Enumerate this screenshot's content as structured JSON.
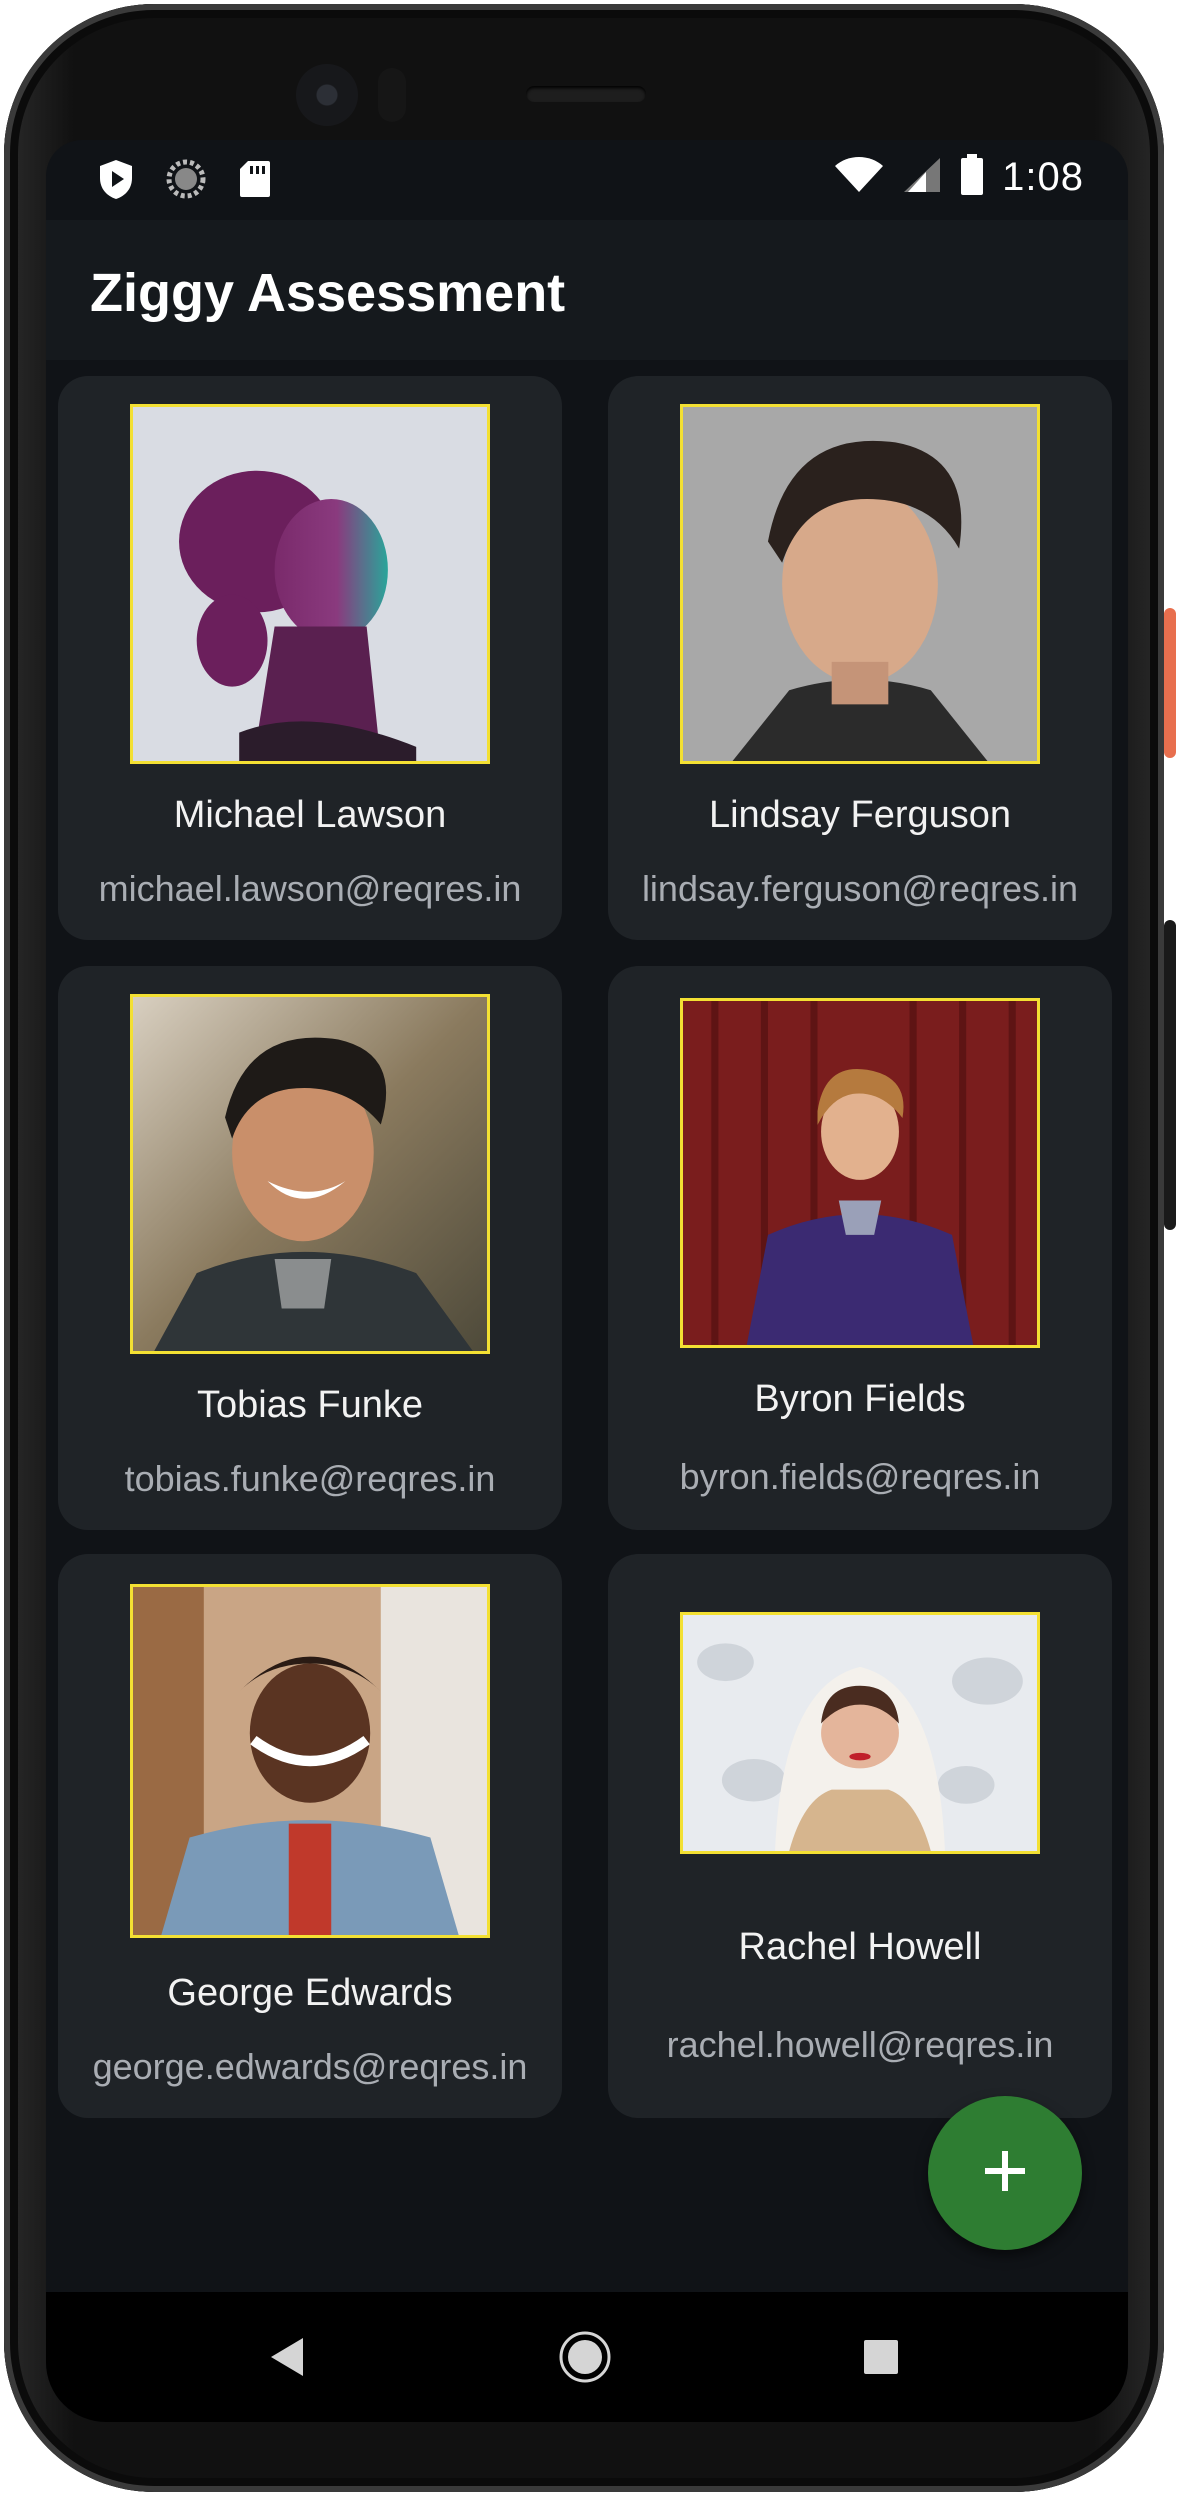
{
  "status": {
    "time": "1:08"
  },
  "app": {
    "title": "Ziggy Assessment"
  },
  "users": [
    {
      "name": "Michael Lawson",
      "email": "michael.lawson@reqres.in"
    },
    {
      "name": "Lindsay Ferguson",
      "email": "lindsay.ferguson@reqres.in"
    },
    {
      "name": "Tobias Funke",
      "email": "tobias.funke@reqres.in"
    },
    {
      "name": "Byron Fields",
      "email": "byron.fields@reqres.in"
    },
    {
      "name": "George Edwards",
      "email": "george.edwards@reqres.in"
    },
    {
      "name": "Rachel Howell",
      "email": "rachel.howell@reqres.in"
    }
  ],
  "fab": {
    "icon": "plus-icon"
  },
  "nav": {
    "back_icon": "back-icon",
    "home_icon": "home-icon",
    "recents_icon": "recents-icon"
  },
  "colors": {
    "background": "#101317",
    "card": "#1f2327",
    "accent_border": "#f3e033",
    "fab": "#2e7d32"
  }
}
